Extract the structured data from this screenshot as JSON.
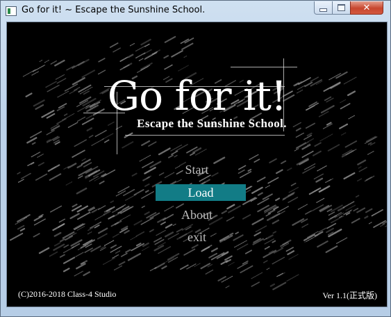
{
  "window": {
    "title": "Go for it! ~ Escape the Sunshine School.",
    "close_glyph": "✕"
  },
  "game": {
    "logo_title": "Go for it!",
    "logo_subtitle": "Escape the Sunshine School.",
    "menu": [
      {
        "label": "Start",
        "selected": false
      },
      {
        "label": "Load",
        "selected": true
      },
      {
        "label": "About",
        "selected": false
      },
      {
        "label": "exit",
        "selected": false
      }
    ],
    "copyright": "(C)2016-2018 Class-4 Studio",
    "version": "Ver 1.1(正式版)"
  },
  "colors": {
    "selection": "#127c86",
    "menu_text": "#bdbdbd",
    "background": "#000000"
  }
}
